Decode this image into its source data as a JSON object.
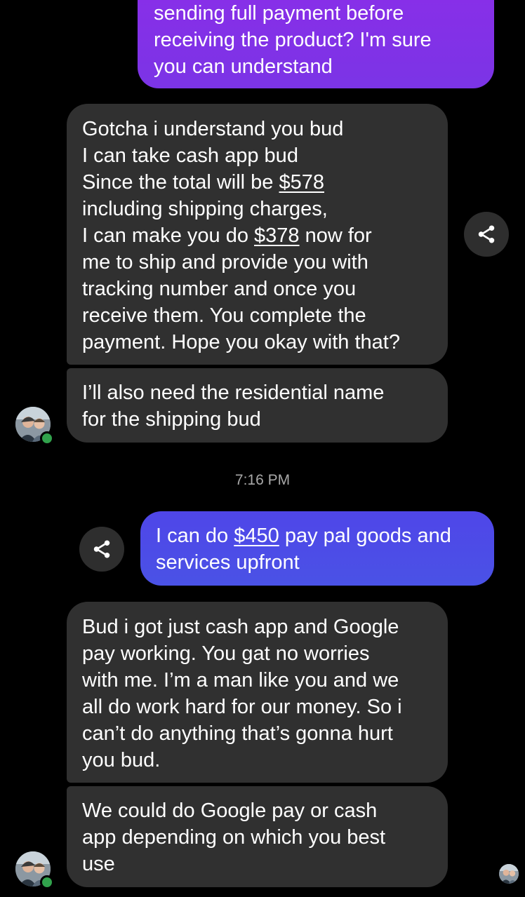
{
  "messages": {
    "m1": {
      "line1": "sending full payment before",
      "line2": "receiving the product? I'm sure",
      "line3": "you can understand"
    },
    "m2": {
      "line1": "Gotcha i understand you bud",
      "line2": "I can take cash app bud",
      "line3_pre": "Since the total will be ",
      "line3_amount": "$578",
      "line4": "including shipping charges,",
      "line5_pre": "I can make you do ",
      "line5_amount": "$378",
      "line5_post": " now for",
      "line6": "me to ship and provide you with",
      "line7": "tracking number and once you",
      "line8": "receive them. You complete the",
      "line9": "payment. Hope you okay with that?"
    },
    "m3": {
      "line1": "I’ll also need the residential name",
      "line2": "for the shipping bud"
    },
    "timestamp": "7:16 PM",
    "m4": {
      "line1_pre": "I can do ",
      "line1_amount": "$450",
      "line1_post": " pay pal goods and",
      "line2": "services upfront"
    },
    "m5": {
      "line1": "Bud i got just cash app and Google",
      "line2": "pay working. You gat no worries",
      "line3": "with me. I’m a man like you and we",
      "line4": "all do work hard for our money. So i",
      "line5": "can’t do anything that’s gonna hurt",
      "line6": "you bud."
    },
    "m6": {
      "line1": "We could do Google pay or cash",
      "line2": "app depending on which you best",
      "line3": "use"
    }
  },
  "icons": {
    "share": "share-icon",
    "avatar": "contact-avatar",
    "read_receipt": "read-receipt-avatar"
  },
  "colors": {
    "background": "#000000",
    "incoming_bubble": "#303030",
    "outgoing_purple": "#8a2ee8",
    "outgoing_blue": "#4f46e8",
    "online_indicator": "#31a24c",
    "timestamp_text": "#a8a8a8"
  }
}
